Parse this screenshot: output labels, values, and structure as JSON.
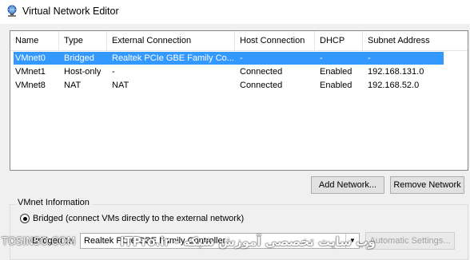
{
  "window": {
    "title": "Virtual Network Editor"
  },
  "table": {
    "columns": [
      "Name",
      "Type",
      "External Connection",
      "Host Connection",
      "DHCP",
      "Subnet Address"
    ],
    "rows": [
      {
        "name": "VMnet0",
        "type": "Bridged",
        "external": "Realtek PCIe GBE Family Co...",
        "host": "-",
        "dhcp": "-",
        "subnet": "-"
      },
      {
        "name": "VMnet1",
        "type": "Host-only",
        "external": "-",
        "host": "Connected",
        "dhcp": "Enabled",
        "subnet": "192.168.131.0"
      },
      {
        "name": "VMnet8",
        "type": "NAT",
        "external": "NAT",
        "host": "Connected",
        "dhcp": "Enabled",
        "subnet": "192.168.52.0"
      }
    ],
    "selected_row": 0,
    "selection_color": "#3399ff"
  },
  "buttons": {
    "add_network": "Add Network...",
    "remove_network": "Remove Network",
    "automatic_settings": "Automatic Settings..."
  },
  "vmnet_info": {
    "group_label": "VMnet Information",
    "bridged_radio_label": "Bridged (connect VMs directly to the external network)",
    "bridged_to_label": "Bridged to:",
    "bridged_to_value": "Realtek PCIe GBE Family Controller"
  },
  "watermark": {
    "left_text": "TOSINSO.COM",
    "right_text": "ITPro.ir - وب سایت تخصصی آموزش شبکه"
  },
  "icons": {
    "title_icon": "network-globe-icon",
    "combo_arrow": "chevron-down-icon"
  }
}
